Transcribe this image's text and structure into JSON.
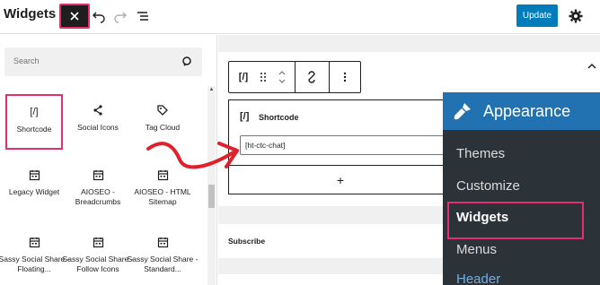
{
  "header": {
    "title": "Widgets",
    "close_icon": "close-icon",
    "undo_icon": "undo-icon",
    "redo_icon": "redo-icon",
    "list_view_icon": "list-view-icon",
    "update_label": "Update",
    "settings_icon": "gear-icon",
    "accent_color": "#007cba",
    "highlight_color": "#e2306c"
  },
  "inserter": {
    "search_placeholder": "Search",
    "blocks": [
      {
        "label": "Shortcode",
        "icon": "[/]"
      },
      {
        "label": "Social Icons",
        "icon": "share-icon"
      },
      {
        "label": "Tag Cloud",
        "icon": "tag-icon"
      },
      {
        "label": "Legacy Widget",
        "icon": "calendar-icon"
      },
      {
        "label": "AIOSEO - Breadcrumbs",
        "icon": "calendar-icon"
      },
      {
        "label": "AIOSEO - HTML Sitemap",
        "icon": "calendar-icon"
      },
      {
        "label": "Sassy Social Share - Floating...",
        "icon": "calendar-icon"
      },
      {
        "label": "Sassy Social Share - Follow Icons",
        "icon": "calendar-icon"
      },
      {
        "label": "Sassy Social Share - Standard...",
        "icon": "calendar-icon"
      }
    ]
  },
  "editor": {
    "toolbar": {
      "block_icon": "[/]",
      "drag_icon": "drag-handle-icon",
      "move_icon": "move-up-down-icon",
      "transform_icon": "transform-icon",
      "more_icon": "more-options-icon"
    },
    "shortcode_block": {
      "icon": "[/]",
      "title": "Shortcode",
      "value": "[ht-ctc-chat]"
    },
    "add_block_label": "+",
    "subscribe_label": "Subscribe"
  },
  "admin_menu": {
    "header_label": "Appearance",
    "header_icon": "paintbrush-icon",
    "items": [
      {
        "label": "Themes"
      },
      {
        "label": "Customize"
      },
      {
        "label": "Widgets"
      },
      {
        "label": "Menus"
      },
      {
        "label": "Header"
      }
    ]
  }
}
